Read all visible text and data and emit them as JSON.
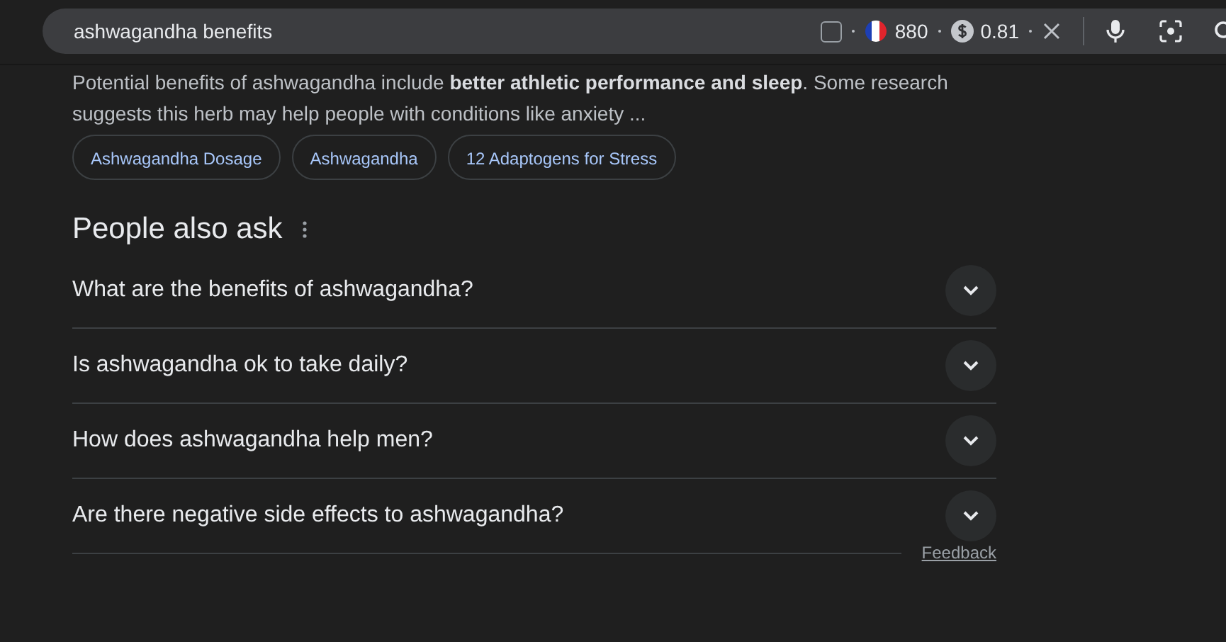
{
  "search": {
    "value": "ashwagandha benefits",
    "checkbox": {
      "checked": false
    },
    "count": "880",
    "score": "0.81"
  },
  "snippet": "Potential benefits of ashwagandha include **better athletic performance and sleep**. Some research suggests this herb may help people with conditions like anxiety ...",
  "chips": [
    "Ashwagandha Dosage",
    "Ashwagandha",
    "12 Adaptogens for Stress"
  ],
  "people_also_ask": {
    "title": "People also ask",
    "questions": [
      {
        "text": "What are the benefits of ashwagandha?",
        "expanded": false
      },
      {
        "text": "Is ashwagandha ok to take daily?",
        "expanded": false
      },
      {
        "text": "How does ashwagandha help men?",
        "expanded": false
      },
      {
        "text": "Are there negative side effects to ashwagandha?",
        "expanded": false
      }
    ],
    "feedback": "Feedback"
  }
}
